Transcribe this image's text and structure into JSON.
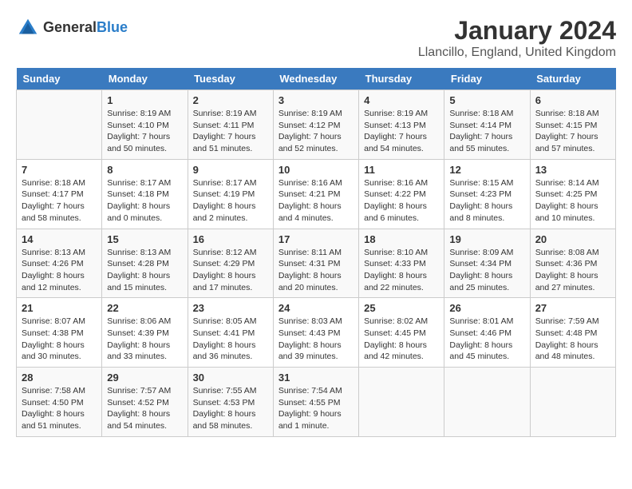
{
  "header": {
    "logo_general": "General",
    "logo_blue": "Blue",
    "month_title": "January 2024",
    "location": "Llancillo, England, United Kingdom"
  },
  "days_of_week": [
    "Sunday",
    "Monday",
    "Tuesday",
    "Wednesday",
    "Thursday",
    "Friday",
    "Saturday"
  ],
  "weeks": [
    [
      {
        "day": "",
        "info": ""
      },
      {
        "day": "1",
        "info": "Sunrise: 8:19 AM\nSunset: 4:10 PM\nDaylight: 7 hours\nand 50 minutes."
      },
      {
        "day": "2",
        "info": "Sunrise: 8:19 AM\nSunset: 4:11 PM\nDaylight: 7 hours\nand 51 minutes."
      },
      {
        "day": "3",
        "info": "Sunrise: 8:19 AM\nSunset: 4:12 PM\nDaylight: 7 hours\nand 52 minutes."
      },
      {
        "day": "4",
        "info": "Sunrise: 8:19 AM\nSunset: 4:13 PM\nDaylight: 7 hours\nand 54 minutes."
      },
      {
        "day": "5",
        "info": "Sunrise: 8:18 AM\nSunset: 4:14 PM\nDaylight: 7 hours\nand 55 minutes."
      },
      {
        "day": "6",
        "info": "Sunrise: 8:18 AM\nSunset: 4:15 PM\nDaylight: 7 hours\nand 57 minutes."
      }
    ],
    [
      {
        "day": "7",
        "info": "Sunrise: 8:18 AM\nSunset: 4:17 PM\nDaylight: 7 hours\nand 58 minutes."
      },
      {
        "day": "8",
        "info": "Sunrise: 8:17 AM\nSunset: 4:18 PM\nDaylight: 8 hours\nand 0 minutes."
      },
      {
        "day": "9",
        "info": "Sunrise: 8:17 AM\nSunset: 4:19 PM\nDaylight: 8 hours\nand 2 minutes."
      },
      {
        "day": "10",
        "info": "Sunrise: 8:16 AM\nSunset: 4:21 PM\nDaylight: 8 hours\nand 4 minutes."
      },
      {
        "day": "11",
        "info": "Sunrise: 8:16 AM\nSunset: 4:22 PM\nDaylight: 8 hours\nand 6 minutes."
      },
      {
        "day": "12",
        "info": "Sunrise: 8:15 AM\nSunset: 4:23 PM\nDaylight: 8 hours\nand 8 minutes."
      },
      {
        "day": "13",
        "info": "Sunrise: 8:14 AM\nSunset: 4:25 PM\nDaylight: 8 hours\nand 10 minutes."
      }
    ],
    [
      {
        "day": "14",
        "info": "Sunrise: 8:13 AM\nSunset: 4:26 PM\nDaylight: 8 hours\nand 12 minutes."
      },
      {
        "day": "15",
        "info": "Sunrise: 8:13 AM\nSunset: 4:28 PM\nDaylight: 8 hours\nand 15 minutes."
      },
      {
        "day": "16",
        "info": "Sunrise: 8:12 AM\nSunset: 4:29 PM\nDaylight: 8 hours\nand 17 minutes."
      },
      {
        "day": "17",
        "info": "Sunrise: 8:11 AM\nSunset: 4:31 PM\nDaylight: 8 hours\nand 20 minutes."
      },
      {
        "day": "18",
        "info": "Sunrise: 8:10 AM\nSunset: 4:33 PM\nDaylight: 8 hours\nand 22 minutes."
      },
      {
        "day": "19",
        "info": "Sunrise: 8:09 AM\nSunset: 4:34 PM\nDaylight: 8 hours\nand 25 minutes."
      },
      {
        "day": "20",
        "info": "Sunrise: 8:08 AM\nSunset: 4:36 PM\nDaylight: 8 hours\nand 27 minutes."
      }
    ],
    [
      {
        "day": "21",
        "info": "Sunrise: 8:07 AM\nSunset: 4:38 PM\nDaylight: 8 hours\nand 30 minutes."
      },
      {
        "day": "22",
        "info": "Sunrise: 8:06 AM\nSunset: 4:39 PM\nDaylight: 8 hours\nand 33 minutes."
      },
      {
        "day": "23",
        "info": "Sunrise: 8:05 AM\nSunset: 4:41 PM\nDaylight: 8 hours\nand 36 minutes."
      },
      {
        "day": "24",
        "info": "Sunrise: 8:03 AM\nSunset: 4:43 PM\nDaylight: 8 hours\nand 39 minutes."
      },
      {
        "day": "25",
        "info": "Sunrise: 8:02 AM\nSunset: 4:45 PM\nDaylight: 8 hours\nand 42 minutes."
      },
      {
        "day": "26",
        "info": "Sunrise: 8:01 AM\nSunset: 4:46 PM\nDaylight: 8 hours\nand 45 minutes."
      },
      {
        "day": "27",
        "info": "Sunrise: 7:59 AM\nSunset: 4:48 PM\nDaylight: 8 hours\nand 48 minutes."
      }
    ],
    [
      {
        "day": "28",
        "info": "Sunrise: 7:58 AM\nSunset: 4:50 PM\nDaylight: 8 hours\nand 51 minutes."
      },
      {
        "day": "29",
        "info": "Sunrise: 7:57 AM\nSunset: 4:52 PM\nDaylight: 8 hours\nand 54 minutes."
      },
      {
        "day": "30",
        "info": "Sunrise: 7:55 AM\nSunset: 4:53 PM\nDaylight: 8 hours\nand 58 minutes."
      },
      {
        "day": "31",
        "info": "Sunrise: 7:54 AM\nSunset: 4:55 PM\nDaylight: 9 hours\nand 1 minute."
      },
      {
        "day": "",
        "info": ""
      },
      {
        "day": "",
        "info": ""
      },
      {
        "day": "",
        "info": ""
      }
    ]
  ]
}
